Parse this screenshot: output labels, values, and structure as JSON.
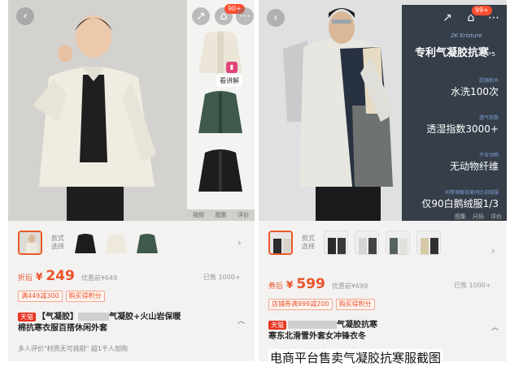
{
  "left": {
    "thumb_tabs": [
      "视频",
      "图集",
      "评价"
    ],
    "explain_label": "看讲解",
    "cart_badge": "90+",
    "style_label": "款式\n选择",
    "price_prefix": "折后",
    "currency": "¥",
    "price": "249",
    "orig_price": "优惠前¥649",
    "sold": "已售 1000+",
    "promos": [
      "满449减300",
      "购买得积分"
    ],
    "store_tag": "天猫",
    "title_line1_a": "【气凝胶】",
    "title_line1_b": "气凝胶+火山岩保暖",
    "title_line2": "棉抗寒衣服百搭休闲外套",
    "review_text": "多人评价\"材质无可挑剔\"  超1千人加购"
  },
  "right": {
    "cart_badge": "99+",
    "brand": "2K Kristure",
    "feature_title": "专利气凝胶抗寒",
    "feature_sup": "*5",
    "features": [
      {
        "small": "超强耐水",
        "big": "水洗100次"
      },
      {
        "small": "透气指数",
        "big": "透湿指数3000+"
      },
      {
        "small": "不含动物",
        "big": "无动物纤维"
      },
      {
        "small": "同等保暖效果同比羽绒服",
        "big": "仅90白鹅绒服1/3"
      }
    ],
    "feature_tabs": [
      "图集",
      "尺码",
      "评价"
    ],
    "price_prefix": "券后",
    "currency": "¥",
    "price": "599",
    "orig_price": "优惠前¥699",
    "sold": "已售 1000+",
    "promos": [
      "店铺券满999减200",
      "购买得积分"
    ],
    "store_tag": "天猫",
    "title_line1": "气凝胶抗寒",
    "title_line2": "寒东北滑雪外套女冲锋衣冬"
  },
  "caption": "电商平台售卖气凝胶抗寒服截图",
  "colors": {
    "accent": "#e8542a",
    "tmall": "#e8321e",
    "feature_bg": "#19232f"
  }
}
